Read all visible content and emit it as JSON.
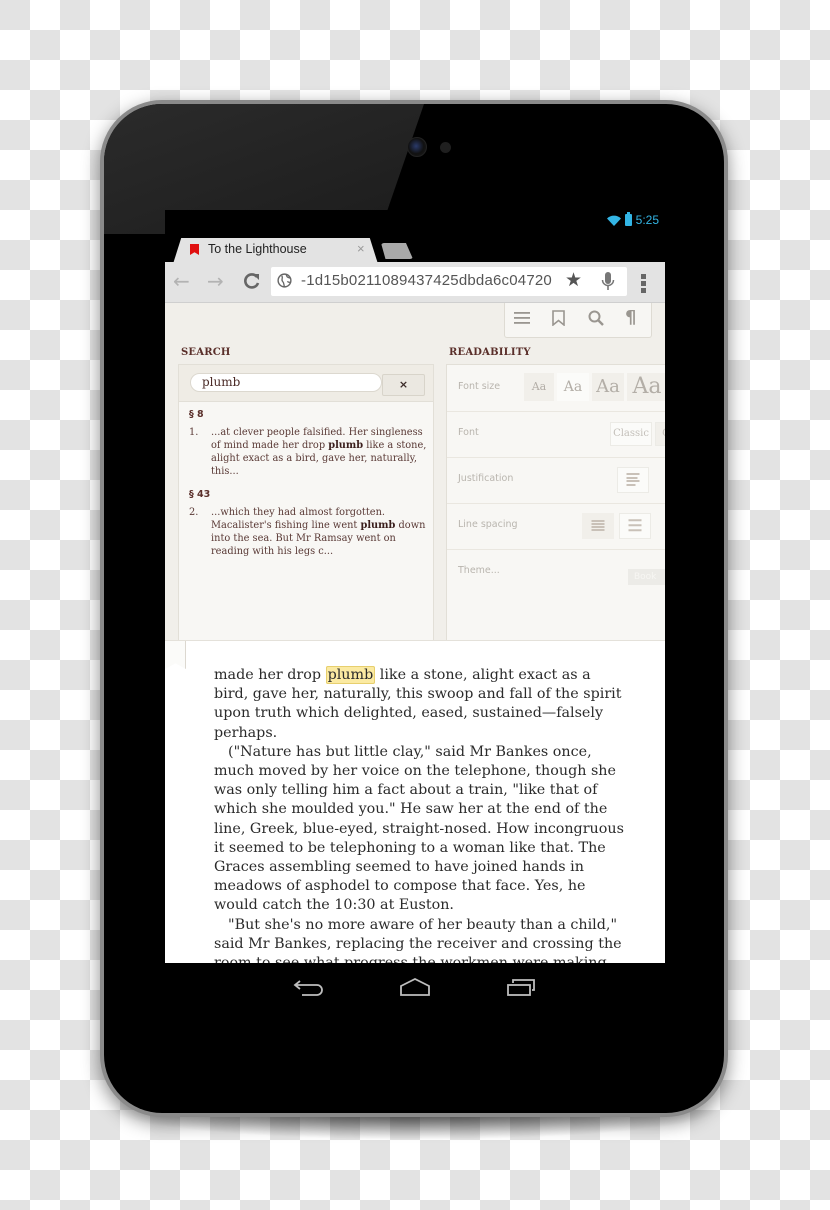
{
  "status_bar": {
    "time": "5:25",
    "icons": [
      "wifi-icon",
      "battery-icon"
    ]
  },
  "browser": {
    "tabs": [
      {
        "title": "To the Lighthouse",
        "favicon": "bookmark-icon",
        "close": "×",
        "active": true
      }
    ],
    "new_tab": "new-tab-button",
    "nav": {
      "back": "←",
      "forward": "→",
      "reload": "C"
    },
    "url": "-1d15b0211089437425dbda6c04720",
    "star": "★"
  },
  "reader_toolbar": {
    "icons": [
      "contents-icon",
      "bookmark-icon",
      "search-icon",
      "paragraph-icon"
    ],
    "paragraph_glyph": "¶"
  },
  "search": {
    "label": "SEARCH",
    "query": "plumb",
    "clear_label": "×",
    "results": [
      {
        "section": "§ 8",
        "number": "1.",
        "before": "...at clever people falsified. Her singleness of mind made her drop ",
        "match": "plumb",
        "after": " like a stone, alight exact as a bird, gave her, naturally, this..."
      },
      {
        "section": "§ 43",
        "number": "2.",
        "before": "...which they had almost forgotten. Macalister's fishing line went ",
        "match": "plumb",
        "after": " down into the sea. But Mr Ramsay went on reading with his legs c..."
      }
    ]
  },
  "readability": {
    "label": "READABILITY",
    "font_size": {
      "label": "Font size",
      "options": [
        "Aa",
        "Aa",
        "Aa",
        "Aa"
      ]
    },
    "font": {
      "label": "Font",
      "options": [
        "Classic",
        "C"
      ]
    },
    "justification": {
      "label": "Justification"
    },
    "line_spacing": {
      "label": "Line spacing"
    },
    "theme": {
      "label": "Theme...",
      "option": "Book"
    }
  },
  "book": {
    "highlight": "plumb",
    "paragraphs": [
      {
        "indent": false,
        "before": "made her drop ",
        "match": "plumb",
        "after": " like a stone, alight exact as a bird, gave her, naturally, this swoop and fall of the spirit upon truth which delighted, eased, sustained—falsely perhaps."
      },
      {
        "indent": true,
        "text": "(\"Nature has but little clay,\" said Mr Bankes once, much moved by her voice on the telephone, though she was only telling him a fact about a train, \"like that of which she moulded you.\" He saw her at the end of the line, Greek, blue-eyed, straight-nosed. How incongruous it seemed to be telephoning to a woman like that. The Graces assembling seemed to have joined hands in meadows of asphodel to compose that face. Yes, he would catch the 10:30 at Euston."
      },
      {
        "indent": true,
        "text": "\"But she's no more aware of her beauty than a child,\" said Mr Bankes, replacing the receiver and crossing the room to see what progress the workmen were making"
      }
    ]
  },
  "system_nav": {
    "buttons": [
      "back-button",
      "home-button",
      "recent-apps-button"
    ]
  }
}
